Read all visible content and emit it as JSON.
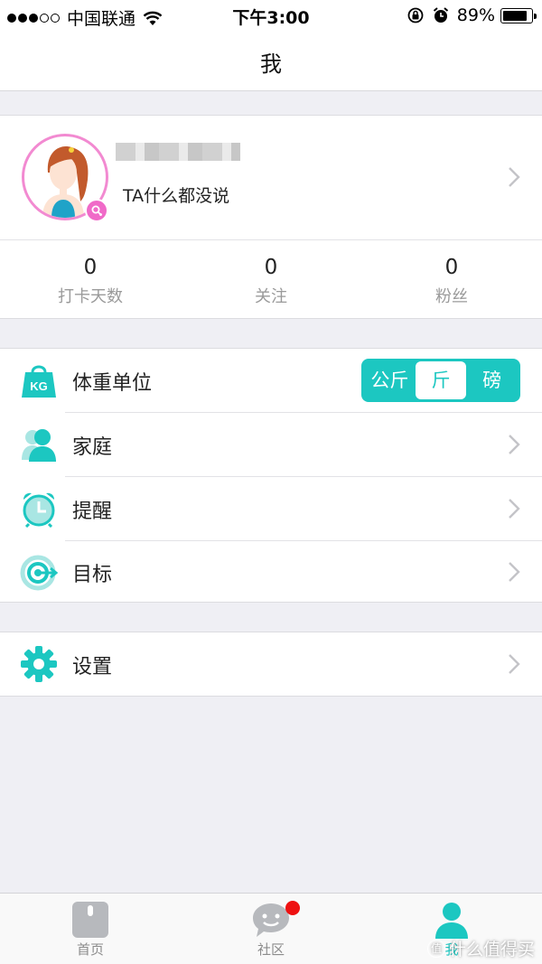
{
  "status_bar": {
    "carrier": "中国联通",
    "time": "下午3:00",
    "battery_percent": "89%",
    "battery_level": 0.89,
    "signal_bars_filled": 3,
    "signal_bars_total": 5
  },
  "nav": {
    "title": "我"
  },
  "profile": {
    "signature": "TA什么都没说",
    "avatar_icon": "female-avatar-icon",
    "gender_icon": "female-gender-icon",
    "stats": [
      {
        "value": "0",
        "label": "打卡天数"
      },
      {
        "value": "0",
        "label": "关注"
      },
      {
        "value": "0",
        "label": "粉丝"
      }
    ]
  },
  "menu": {
    "weight_unit": {
      "label": "体重单位",
      "icon": "kg-weight-icon",
      "icon_text": "KG",
      "options": [
        "公斤",
        "斤",
        "磅"
      ],
      "selected": "斤"
    },
    "items": [
      {
        "label": "家庭",
        "icon": "family-user-icon"
      },
      {
        "label": "提醒",
        "icon": "alarm-clock-icon"
      },
      {
        "label": "目标",
        "icon": "target-icon"
      }
    ]
  },
  "settings": {
    "label": "设置",
    "icon": "gear-icon"
  },
  "tabs": [
    {
      "label": "首页",
      "icon": "scale-icon",
      "active": false
    },
    {
      "label": "社区",
      "icon": "chat-bubble-icon",
      "active": false,
      "badge": true
    },
    {
      "label": "我",
      "icon": "person-icon",
      "active": true
    }
  ],
  "watermark": {
    "text": "什么值得买",
    "badge": "值"
  },
  "colors": {
    "accent": "#1cc7c1",
    "avatar_ring": "#f28ad1",
    "badge_red": "#ee1111",
    "background": "#efeff4"
  }
}
